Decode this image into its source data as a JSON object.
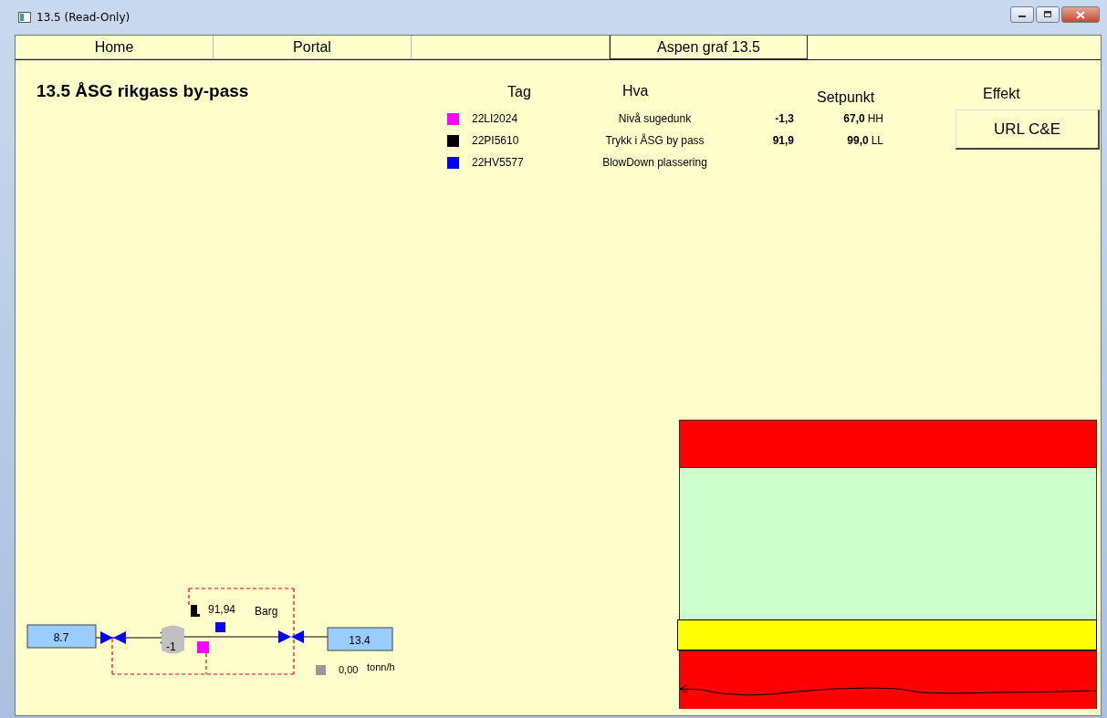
{
  "window": {
    "title": "13.5 (Read-Only)"
  },
  "tabs": [
    {
      "label": "Home",
      "selected": false
    },
    {
      "label": "Portal",
      "selected": false
    },
    {
      "label": "Aspen graf 13.5",
      "selected": true
    }
  ],
  "page_title": "13.5 ÅSG rikgass by-pass",
  "legend": {
    "headers": {
      "tag": "Tag",
      "hva": "Hva",
      "setpoint": "Setpunkt",
      "effect": "Effekt"
    },
    "rows": [
      {
        "color": "#ff00ff",
        "tag": "22LI2024",
        "hva": "Nivå sugedunk",
        "value": "-1,3",
        "setpoint": "67,0",
        "limit": "HH"
      },
      {
        "color": "#000000",
        "tag": "22PI5610",
        "hva": "Trykk i ÅSG by pass",
        "value": "91,9",
        "setpoint": "99,0",
        "limit": "LL"
      },
      {
        "color": "#0000ff",
        "tag": "22HV5577",
        "hva": "BlowDown plassering"
      }
    ],
    "button": "URL C&E"
  },
  "diagram": {
    "inlet": "8.7",
    "outlet": "13.4",
    "vessel": "-1",
    "pressure": "91,94",
    "pressure_unit": "Barg",
    "flow": "0,00",
    "flow_unit": "tonn/h"
  },
  "trend": {
    "bands": [
      {
        "color": "#ff0000"
      },
      {
        "color": "#ccffcc"
      },
      {
        "color": "#ffff00"
      },
      {
        "color": "#ff0000"
      }
    ]
  }
}
